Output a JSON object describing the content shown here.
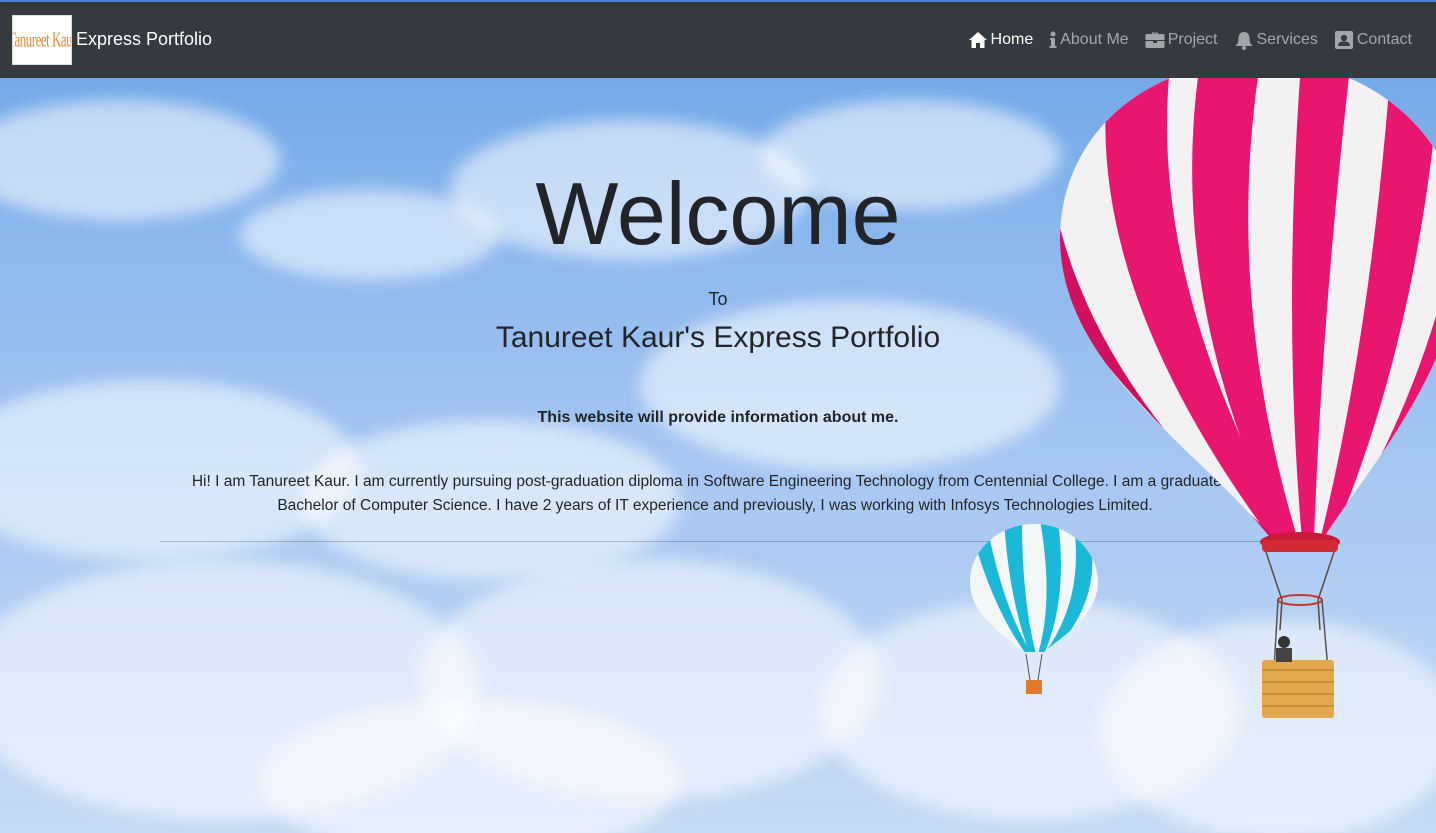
{
  "navbar": {
    "logo_text": "Tanureet Kaur",
    "brand": "Express Portfolio",
    "items": [
      {
        "label": "Home",
        "icon": "home-icon",
        "active": true
      },
      {
        "label": "About Me",
        "icon": "info-icon",
        "active": false
      },
      {
        "label": "Project",
        "icon": "briefcase-icon",
        "active": false
      },
      {
        "label": "Services",
        "icon": "bell-icon",
        "active": false
      },
      {
        "label": "Contact",
        "icon": "contact-card-icon",
        "active": false
      }
    ]
  },
  "hero": {
    "welcome": "Welcome",
    "to": "To",
    "subtitle": "Tanureet Kaur's Express Portfolio",
    "tagline": "This website will provide information about me.",
    "bio": "Hi! I am Tanureet Kaur. I am currently pursuing post-graduation diploma in Software Engineering Technology from Centennial College. I am a graduate in Bachelor of Computer Science. I have 2 years of IT experience and previously, I was working with Infosys Technologies Limited."
  },
  "colors": {
    "navbar_bg": "#343a40",
    "nav_active": "#ffffff",
    "nav_inactive": "rgba(255,255,255,0.55)",
    "balloon_pink": "#e8166f",
    "balloon_cyan": "#1bb8d8"
  }
}
